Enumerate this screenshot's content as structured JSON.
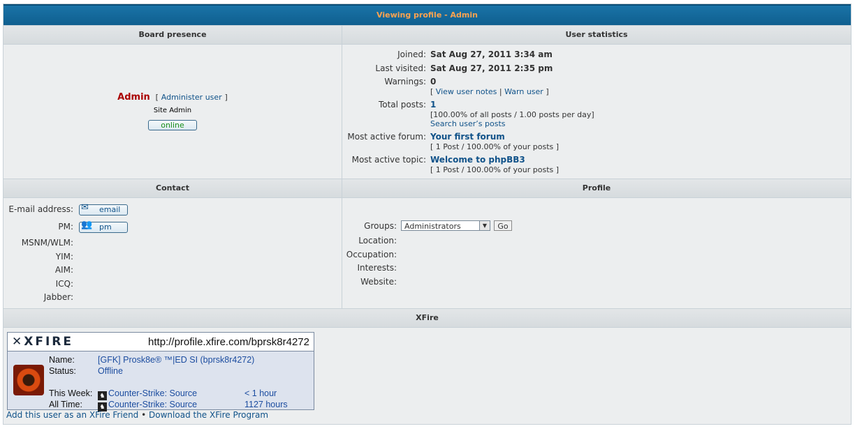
{
  "header": {
    "title": "Viewing profile - Admin"
  },
  "board_presence": {
    "heading": "Board presence",
    "username": "Admin",
    "admin_link_prefix": "[",
    "admin_link": "Administer user",
    "admin_link_suffix": "]",
    "rank": "Site Admin",
    "online_label": "online"
  },
  "user_stats": {
    "heading": "User statistics",
    "joined_label": "Joined:",
    "joined": "Sat Aug 27, 2011 3:34 am",
    "last_visited_label": "Last visited:",
    "last_visited": "Sat Aug 27, 2011 2:35 pm",
    "warnings_label": "Warnings:",
    "warnings": "0",
    "view_notes": "View user notes",
    "warn_user": "Warn user",
    "total_posts_label": "Total posts:",
    "total_posts": "1",
    "posts_detail": "[100.00% of all posts / 1.00 posts per day]",
    "search_posts": "Search user’s posts",
    "active_forum_label": "Most active forum:",
    "active_forum": "Your first forum",
    "active_forum_detail": "[ 1 Post / 100.00% of your posts ]",
    "active_topic_label": "Most active topic:",
    "active_topic": "Welcome to phpBB3",
    "active_topic_detail": "[ 1 Post / 100.00% of your posts ]"
  },
  "contact": {
    "heading": "Contact",
    "email_label": "E-mail address:",
    "email_btn": "email",
    "pm_label": "PM:",
    "pm_btn": "pm",
    "msn_label": "MSNM/WLM:",
    "yim_label": "YIM:",
    "aim_label": "AIM:",
    "icq_label": "ICQ:",
    "jabber_label": "Jabber:"
  },
  "profile": {
    "heading": "Profile",
    "groups_label": "Groups:",
    "groups_selected": "Administrators",
    "go_label": "Go",
    "location_label": "Location:",
    "occupation_label": "Occupation:",
    "interests_label": "Interests:",
    "website_label": "Website:"
  },
  "xfire": {
    "heading": "XFire",
    "logo": "XFIRE",
    "url": "http://profile.xfire.com/bprsk8r4272",
    "name_label": "Name:",
    "name": "[GFK] Prosk8e® ™|ED SI (bprsk8r4272)",
    "status_label": "Status:",
    "status": "Offline",
    "week_label": "This Week:",
    "week_game": "Counter-Strike: Source",
    "week_time": "< 1 hour",
    "all_label": "All Time:",
    "all_game": "Counter-Strike: Source",
    "all_time": "1127 hours",
    "add_friend": "Add this user as an XFire Friend",
    "separator": "•",
    "download": "Download the XFire Program"
  }
}
